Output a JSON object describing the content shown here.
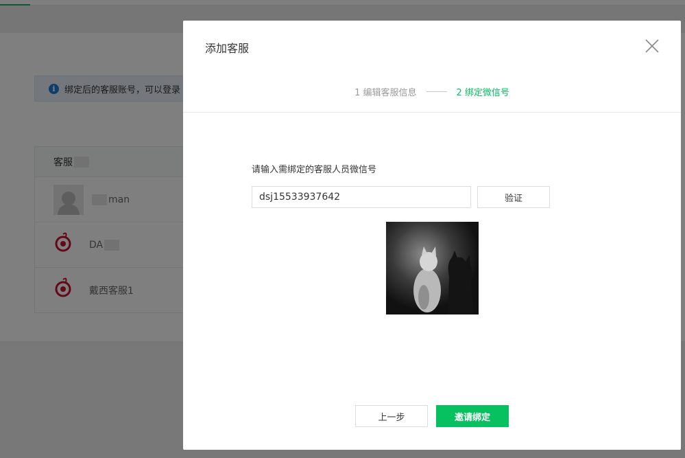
{
  "background": {
    "notice": {
      "text": "绑定后的客服账号，可以登录"
    },
    "table": {
      "header": "客服",
      "rows": [
        {
          "name": "man"
        },
        {
          "name": "DA"
        },
        {
          "name": "戴西客服1"
        }
      ]
    }
  },
  "dialog": {
    "title": "添加客服",
    "steps": [
      {
        "label": "1 编辑客服信息",
        "active": false
      },
      {
        "label": "2 绑定微信号",
        "active": true
      }
    ],
    "field_label": "请输入需绑定的客服人员微信号",
    "wechat_input": {
      "value": "dsj15533937642",
      "placeholder": ""
    },
    "verify_label": "验证",
    "prev_label": "上一步",
    "invite_label": "邀请绑定"
  },
  "colors": {
    "accent": "#07c160",
    "info": "#1d7ed6",
    "logo_red": "#c8102e"
  },
  "icons": {
    "info": "info-icon",
    "close": "close-icon"
  }
}
